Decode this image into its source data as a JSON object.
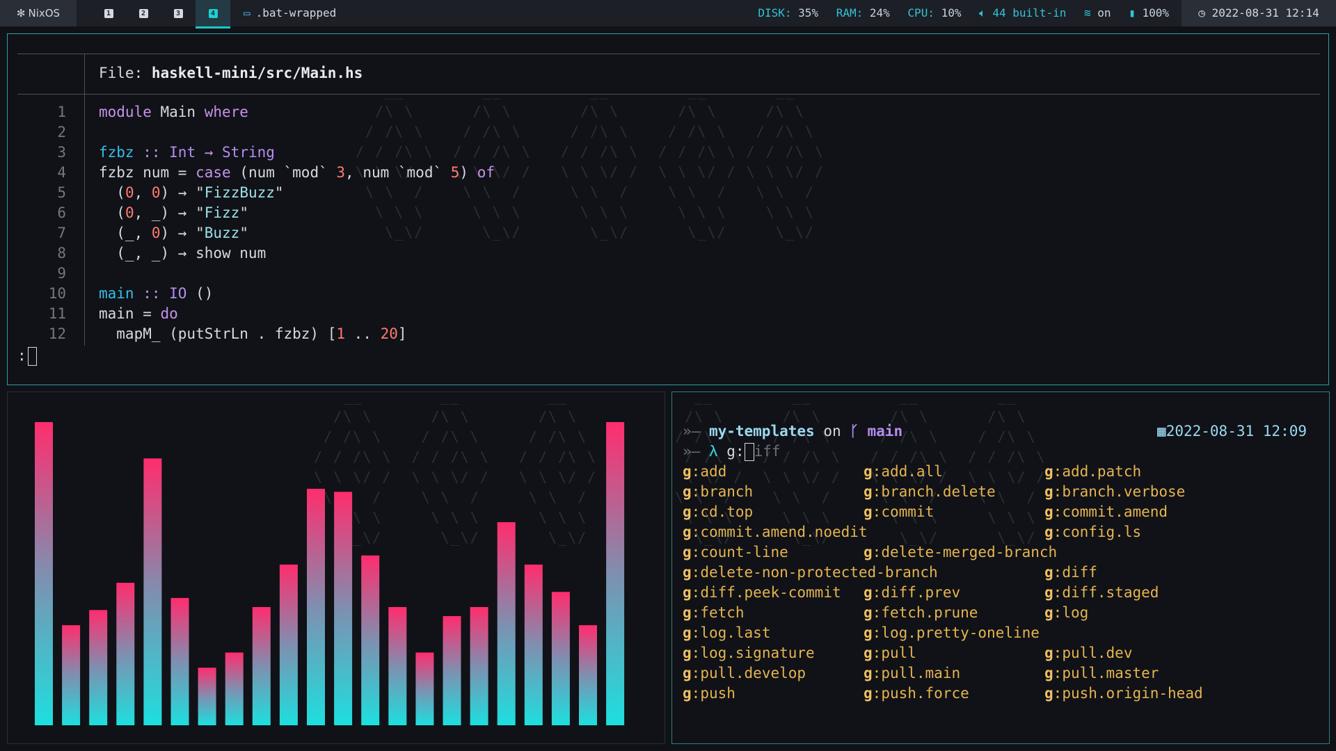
{
  "topbar": {
    "os_label": "NixOS",
    "workspaces": [
      {
        "label": "1",
        "active": false
      },
      {
        "label": "2",
        "active": false
      },
      {
        "label": "3",
        "active": false
      },
      {
        "label": "4",
        "active": true
      }
    ],
    "window_title": ".bat-wrapped",
    "status": {
      "disk_label": "DISK:",
      "disk_value": "35%",
      "ram_label": "RAM:",
      "ram_value": "24%",
      "cpu_label": "CPU:",
      "cpu_value": "10%",
      "volume": "44 built-in",
      "wifi": "on",
      "battery": "100%"
    },
    "clock": "2022-08-31 12:14"
  },
  "bat": {
    "file_prefix": "File: ",
    "file_path": "haskell-mini/src/Main.hs",
    "lines": [
      {
        "n": "1"
      },
      {
        "n": "2"
      },
      {
        "n": "3"
      },
      {
        "n": "4"
      },
      {
        "n": "5"
      },
      {
        "n": "6"
      },
      {
        "n": "7"
      },
      {
        "n": "8"
      },
      {
        "n": "9"
      },
      {
        "n": "10"
      },
      {
        "n": "11"
      },
      {
        "n": "12"
      }
    ],
    "code": {
      "l1": [
        "module",
        " Main ",
        "where"
      ],
      "l3": [
        "fzbz",
        " :: ",
        "Int",
        " → ",
        "String"
      ],
      "l4": [
        "fzbz num = ",
        "case",
        " (num `mod` ",
        "3",
        ", num `mod` ",
        "5",
        ") ",
        "of"
      ],
      "l5": [
        "  (",
        "0",
        ", ",
        "0",
        ") → \"",
        "FizzBuzz",
        "\""
      ],
      "l6": [
        "  (",
        "0",
        ", _) → \"",
        "Fizz",
        "\""
      ],
      "l7": [
        "  (_, ",
        "0",
        ") → \"",
        "Buzz",
        "\""
      ],
      "l8": [
        "  (_, _) → show num"
      ],
      "l10": [
        "main",
        " :: ",
        "IO",
        " ()"
      ],
      "l11": [
        "main = ",
        "do"
      ],
      "l12": [
        "  mapM_ (putStrLn . fzbz) [",
        "1",
        " .. ",
        "20",
        "]"
      ]
    },
    "prompt": ":"
  },
  "visualizer": {
    "levels": [
      1.0,
      0.33,
      0.38,
      0.47,
      0.88,
      0.42,
      0.19,
      0.24,
      0.39,
      0.53,
      0.78,
      0.77,
      0.56,
      0.39,
      0.24,
      0.36,
      0.39,
      0.67,
      0.53,
      0.44,
      0.33,
      1.0
    ],
    "color_top": "#ff2d6e",
    "color_mid": "#7f8fb0",
    "color_bottom": "#1ddfdf"
  },
  "terminal": {
    "prompt_arrow": "»—",
    "directory": "my-templates",
    "on_word": " on ",
    "branch_icon": "ᚴ",
    "branch": "main",
    "date": "2022-08-31 12:09",
    "lambda": "λ",
    "typed": "g:",
    "suggestion_rest": "iff",
    "completions": [
      [
        "add",
        "add.all",
        "add.patch"
      ],
      [
        "branch",
        "branch.delete",
        "branch.verbose"
      ],
      [
        "cd.top",
        "commit",
        "commit.amend"
      ],
      [
        "commit.amend.noedit",
        "",
        "config.ls"
      ],
      [
        "count-line",
        "delete-merged-branch",
        ""
      ],
      [
        "delete-non-protected-branch",
        "",
        "diff"
      ],
      [
        "diff.peek-commit",
        "diff.prev",
        "diff.staged"
      ],
      [
        "fetch",
        "fetch.prune",
        "log"
      ],
      [
        "log.last",
        "log.pretty-oneline",
        ""
      ],
      [
        "log.signature",
        "pull",
        "pull.dev"
      ],
      [
        "pull.develop",
        "pull.main",
        "pull.master"
      ],
      [
        "push",
        "push.force",
        "push.origin-head"
      ]
    ],
    "completion_prefix": "g"
  }
}
